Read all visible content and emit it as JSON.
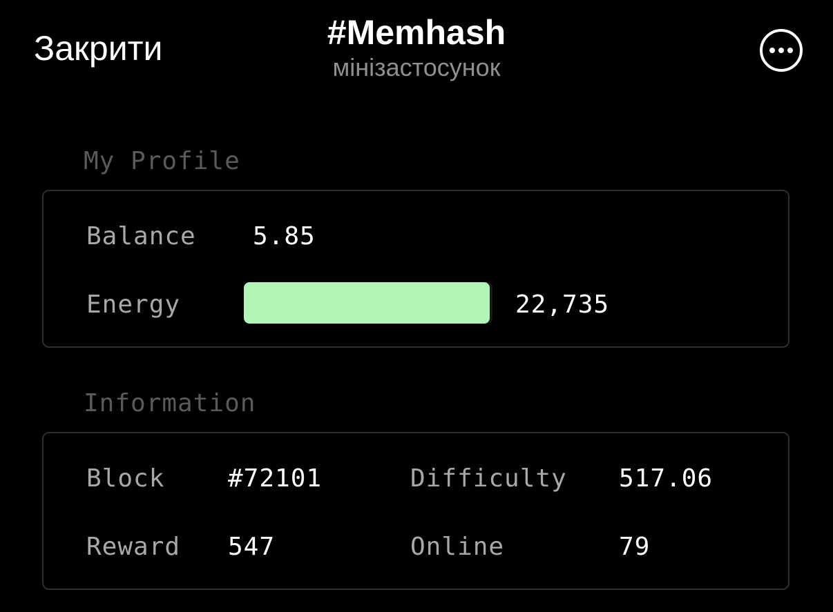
{
  "header": {
    "close_label": "Закрити",
    "title": "#Memhash",
    "subtitle": "мінізастосунок",
    "more_icon": "more-horizontal-circle-icon"
  },
  "profile": {
    "heading": "My Profile",
    "balance_label": "Balance",
    "balance_value": "5.85",
    "energy_label": "Energy",
    "energy_value": "22,735",
    "energy_fill_fraction": 0.99,
    "energy_color": "#b2f5b4"
  },
  "information": {
    "heading": "Information",
    "block_label": "Block",
    "block_value": "#72101",
    "difficulty_label": "Difficulty",
    "difficulty_value": "517.06",
    "reward_label": "Reward",
    "reward_value": "547",
    "online_label": "Online",
    "online_value": "79"
  },
  "colors": {
    "background": "#000000",
    "label": "#a8a8a8",
    "heading": "#5a5a5a",
    "border": "#2e2e2e"
  }
}
